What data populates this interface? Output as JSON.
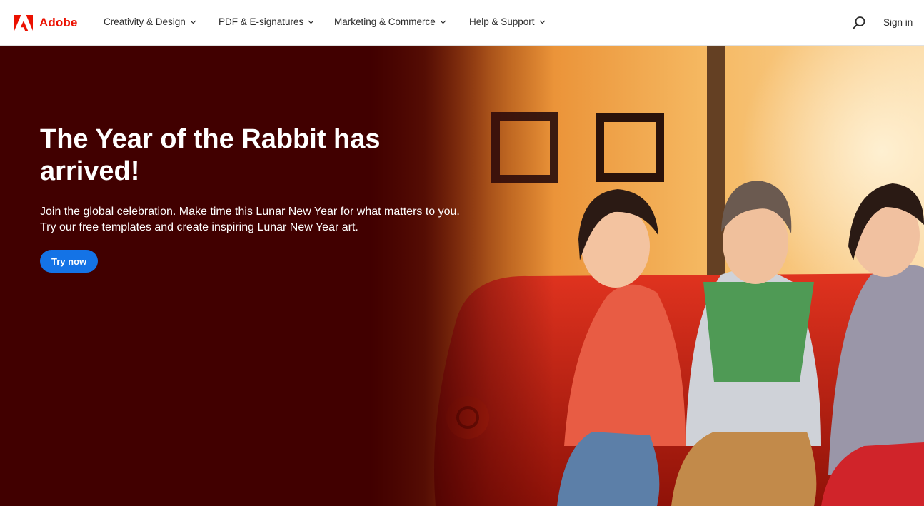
{
  "brand": {
    "name": "Adobe",
    "logo_icon": "adobe-logo-icon",
    "color": "#eb1000"
  },
  "nav": {
    "items": [
      {
        "label": "Creativity & Design",
        "icon": "chevron-down-icon"
      },
      {
        "label": "PDF & E-signatures",
        "icon": "chevron-down-icon"
      },
      {
        "label": "Marketing & Commerce",
        "icon": "chevron-down-icon"
      },
      {
        "label": "Help & Support",
        "icon": "chevron-down-icon"
      }
    ],
    "search_icon": "search-icon",
    "signin_label": "Sign in"
  },
  "hero": {
    "title": "The Year of the Rabbit has arrived!",
    "description": "Join the global celebration. Make time this Lunar New Year for what matters to you. Try our free templates and create inspiring Lunar New Year art.",
    "cta_label": "Try now",
    "background_color": "#410000",
    "cta_color": "#1473e6"
  }
}
